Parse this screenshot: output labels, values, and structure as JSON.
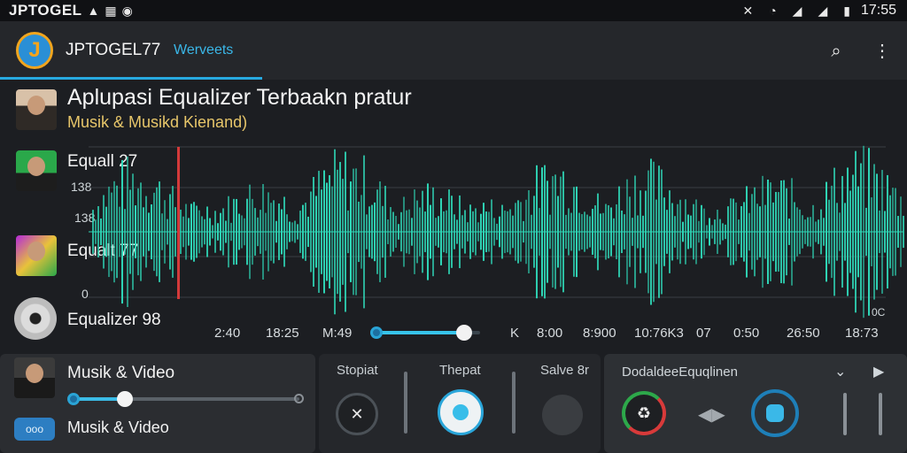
{
  "status_bar": {
    "brand": "JPTOGEL",
    "time": "17:55",
    "icons": [
      "warning-icon",
      "sim-icon",
      "notification-icon",
      "mute-icon",
      "wifi-icon",
      "signal-icon",
      "signal-icon",
      "battery-icon"
    ]
  },
  "app_bar": {
    "logo_letter": "J",
    "title": "JPTOGEL77",
    "subtitle": "Werveets",
    "accent": "#27a9e0"
  },
  "header": {
    "title": "Aplupasi Equalizer Terbaakn pratur",
    "subtitle": "Musik & Musikd Kienand)"
  },
  "rows": [
    {
      "label": "Equall 27"
    },
    {
      "label": "Equalt 77"
    },
    {
      "label": "Equalizer 98"
    }
  ],
  "waveform": {
    "y_labels": [
      "138",
      "138",
      "0"
    ],
    "time_labels": [
      "2:40",
      "18:25",
      "M:49",
      "K",
      "8:00",
      "8:900",
      "10:76K3",
      "07",
      "0:50",
      "26:50",
      "18:73"
    ],
    "corner_label": "0C",
    "wave_color": "#2fd8b8",
    "seek_position": 0.85
  },
  "bottom_left": {
    "title": "Musik & Video",
    "volume_level": 0.23,
    "chip_label": "ooo",
    "footer_label": "Musik & Video"
  },
  "controls": {
    "labels": [
      "Stopiat",
      "Thepat",
      "Salve 8r"
    ]
  },
  "equalizer_panel": {
    "title": "DodaldeeEquqlinen"
  }
}
